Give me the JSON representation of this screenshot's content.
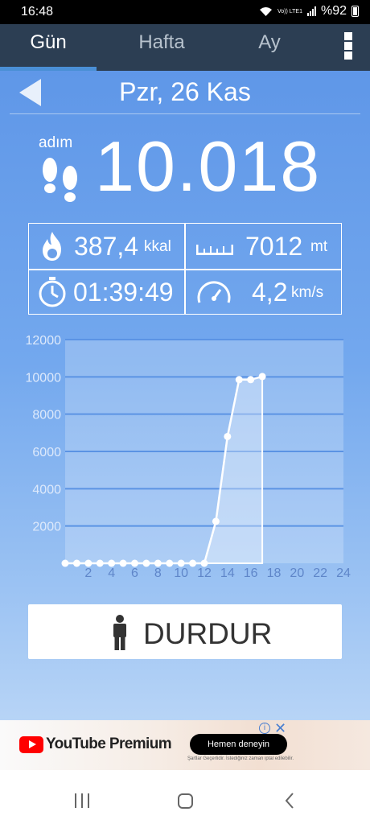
{
  "status_bar": {
    "time": "16:48",
    "network": "Vo)) LTE1",
    "battery": "%92"
  },
  "tabs": [
    {
      "label": "Gün",
      "active": true
    },
    {
      "label": "Hafta",
      "active": false
    },
    {
      "label": "Ay",
      "active": false
    }
  ],
  "header": {
    "date": "Pzr, 26 Kas"
  },
  "steps": {
    "label": "adım",
    "count": "10.018"
  },
  "stats": {
    "calories": {
      "value": "387,4",
      "unit": "kkal",
      "icon": "flame-icon"
    },
    "distance": {
      "value": "7012",
      "unit": "mt",
      "icon": "ruler-icon"
    },
    "duration": {
      "value": "01:39:49",
      "icon": "stopwatch-icon"
    },
    "speed": {
      "value": "4,2",
      "unit": "km/s",
      "icon": "speedometer-icon"
    }
  },
  "chart_data": {
    "type": "line",
    "x": [
      0,
      1,
      2,
      3,
      4,
      5,
      6,
      7,
      8,
      9,
      10,
      11,
      12,
      13,
      14,
      15,
      16,
      17
    ],
    "values": [
      0,
      0,
      0,
      0,
      0,
      0,
      0,
      0,
      0,
      0,
      0,
      0,
      0,
      2250,
      6800,
      9850,
      9850,
      10018
    ],
    "x_ticks": [
      "2",
      "4",
      "6",
      "8",
      "10",
      "12",
      "14",
      "16",
      "18",
      "20",
      "22",
      "24"
    ],
    "y_ticks": [
      "2000",
      "4000",
      "6000",
      "8000",
      "10000",
      "12000"
    ],
    "xlim": [
      0,
      24
    ],
    "ylim": [
      0,
      12000
    ],
    "grid": true
  },
  "stop_button": {
    "label": "DURDUR",
    "icon": "person-icon"
  },
  "ad": {
    "brand": "YouTube Premium",
    "cta": "Hemen deneyin",
    "disclaimer": "Şartlar Geçerlidir. İstediğiniz zaman iptal edilebilir."
  },
  "colors": {
    "tab_bar": "#2c3e53",
    "accent": "#4a8fd6",
    "background_top": "#5f97e8",
    "background_bottom": "#b7d4f6"
  }
}
